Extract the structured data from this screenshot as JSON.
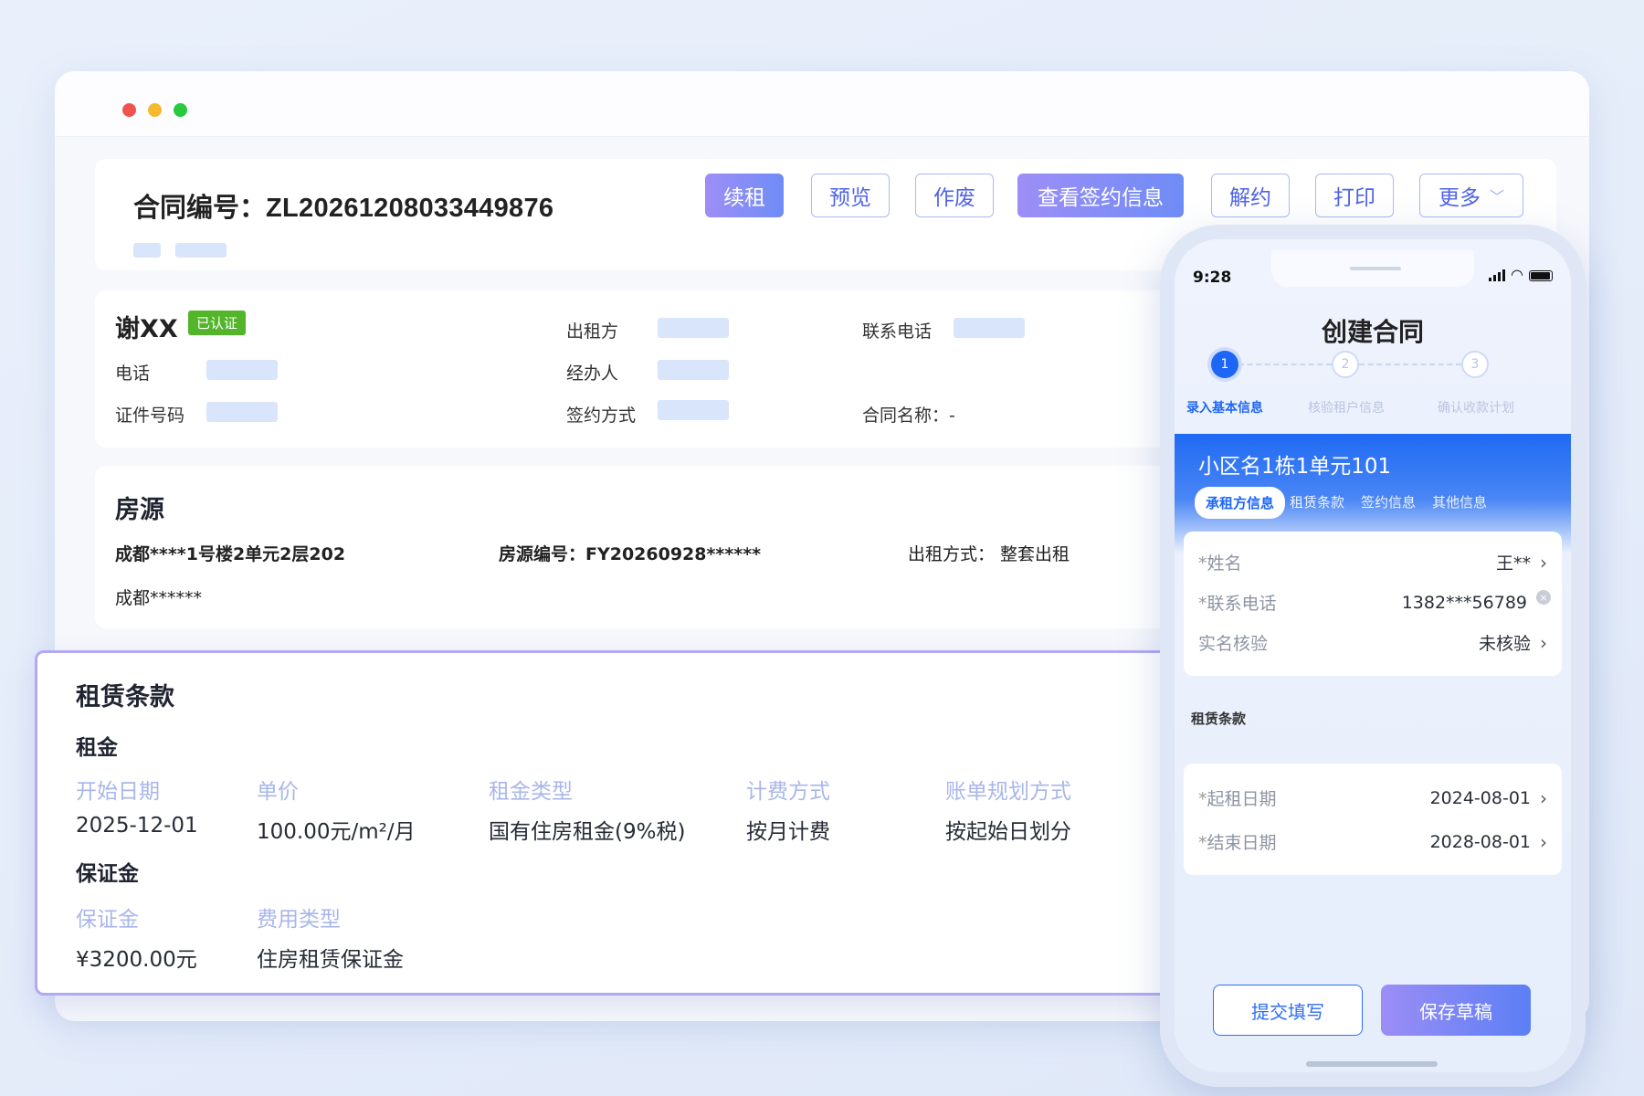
{
  "contract": {
    "label": "合同编号：",
    "number": "ZL20261208033449876"
  },
  "toolbar": {
    "renew": "续租",
    "preview": "预览",
    "void": "作废",
    "sign_info": "查看签约信息",
    "terminate": "解约",
    "print": "打印",
    "more": "更多"
  },
  "tenant": {
    "name": "谢XX",
    "verified": "已认证",
    "phone_label": "电话",
    "id_label": "证件号码",
    "lessor_label": "出租方",
    "handler_label": "经办人",
    "sign_method_label": "签约方式",
    "contact_label": "联系电话",
    "contract_name": "合同名称：-"
  },
  "house": {
    "title": "房源",
    "address": "成都****1号楼2单元2层202",
    "code": "房源编号：FY20260928******",
    "rent_mode": "出租方式：  整套出租",
    "city": "成都******"
  },
  "lease": {
    "title": "租赁条款",
    "rent_title": "租金",
    "rent_headers": [
      "开始日期",
      "单价",
      "租金类型",
      "计费方式",
      "账单规划方式"
    ],
    "rent_values": [
      "2025-12-01",
      "100.00元/m²/月",
      "国有住房租金(9%税)",
      "按月计费",
      "按起始日划分"
    ],
    "deposit_title": "保证金",
    "deposit_headers": [
      "保证金",
      "费用类型"
    ],
    "deposit_values": [
      "¥3200.00元",
      "住房租赁保证金"
    ]
  },
  "phone": {
    "time": "9:28",
    "title": "创建合同",
    "steps": [
      {
        "num": "1",
        "label": "录入基本信息"
      },
      {
        "num": "2",
        "label": "核验租户信息"
      },
      {
        "num": "3",
        "label": "确认收款计划"
      }
    ],
    "address": "小区名1栋1单元101",
    "tabs": [
      "承租方信息",
      "租赁条款",
      "签约信息",
      "其他信息"
    ],
    "fields": {
      "name_label": "姓名",
      "name_value": "王**",
      "phone_label": "联系电话",
      "phone_value": "1382***56789",
      "realname_label": "实名核验",
      "realname_value": "未核验"
    },
    "section": "租赁条款",
    "dates": {
      "start_label": "起租日期",
      "start_value": "2024-08-01",
      "end_label": "结束日期",
      "end_value": "2028-08-01"
    },
    "buttons": {
      "submit": "提交填写",
      "save": "保存草稿"
    }
  },
  "colors": {
    "primary_blue": "#1e66f5",
    "accent_purple": "#9d8ef6",
    "verified_green": "#52b52a"
  }
}
